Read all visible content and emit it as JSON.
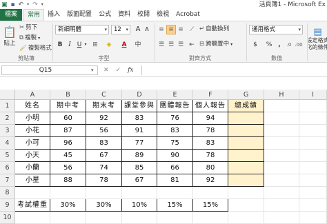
{
  "window": {
    "title": "活頁簿1 - Microsoft Ex"
  },
  "ribbon_tabs": [
    "檔案",
    "常用",
    "插入",
    "版面配置",
    "公式",
    "資料",
    "校閱",
    "檢視",
    "Acrobat"
  ],
  "clipboard": {
    "paste": "貼上",
    "cut": "剪下",
    "copy": "複製",
    "format_painter": "複製格式",
    "label": "剪貼簿"
  },
  "font": {
    "name": "新細明體",
    "size": "12",
    "bold": "B",
    "italic": "I",
    "underline": "U",
    "grow": "A",
    "shrink": "A",
    "label": "字型"
  },
  "alignment": {
    "wrap": "自動換列",
    "merge": "跨欄置中",
    "label": "對齊方式"
  },
  "number": {
    "format": "通用格式",
    "currency": "$",
    "percent": "%",
    "comma": ",",
    "label": "數值"
  },
  "styles": {
    "cond_format_line1": "設定格式",
    "cond_format_line2": "化的條件"
  },
  "namebox": {
    "value": "Q15"
  },
  "fx": {
    "cancel": "✕",
    "enter": "✓",
    "fx": "fx"
  },
  "columns": [
    "A",
    "B",
    "C",
    "D",
    "E",
    "F",
    "G",
    "H",
    "I"
  ],
  "rows": [
    "1",
    "2",
    "3",
    "4",
    "5",
    "6",
    "7",
    "8",
    "9",
    "10"
  ],
  "table": {
    "headers": [
      "姓名",
      "期中考",
      "期末考",
      "課堂參與",
      "團體報告",
      "個人報告",
      "總成績"
    ],
    "rows": [
      [
        "小明",
        "60",
        "92",
        "83",
        "76",
        "94"
      ],
      [
        "小花",
        "87",
        "56",
        "91",
        "83",
        "78"
      ],
      [
        "小可",
        "96",
        "83",
        "77",
        "75",
        "83"
      ],
      [
        "小天",
        "45",
        "67",
        "89",
        "90",
        "78"
      ],
      [
        "小蘭",
        "56",
        "74",
        "85",
        "66",
        "80"
      ],
      [
        "小星",
        "88",
        "78",
        "67",
        "81",
        "92"
      ]
    ],
    "weights_label": "考試權重",
    "weights": [
      "30%",
      "30%",
      "10%",
      "15%",
      "15%"
    ]
  },
  "colors": {
    "file_tab": "#217346",
    "highlight": "#fff2cc",
    "selected_align": "#fbd08e"
  }
}
